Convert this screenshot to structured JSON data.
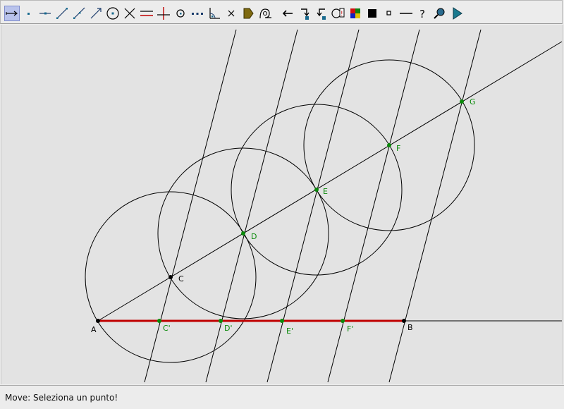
{
  "toolbar": {
    "tools": [
      {
        "name": "move-tool-icon",
        "active": true
      },
      {
        "name": "new-point-tool-icon"
      },
      {
        "name": "point-on-object-tool-icon"
      },
      {
        "name": "segment-tool-icon"
      },
      {
        "name": "ray-tool-icon"
      },
      {
        "name": "vector-tool-icon"
      },
      {
        "name": "circle-tool-icon"
      },
      {
        "name": "intersection-tool-icon"
      },
      {
        "name": "parallel-tool-icon"
      },
      {
        "name": "perpendicular-tool-icon"
      },
      {
        "name": "midpoint-tool-icon"
      },
      {
        "name": "polyline-tool-icon"
      },
      {
        "name": "angle-tool-icon"
      },
      {
        "name": "delete-tool-icon"
      },
      {
        "name": "macro-tool-icon"
      },
      {
        "name": "locus-tool-icon"
      },
      {
        "name": "undo-tool-icon"
      },
      {
        "name": "hide-tool-icon"
      },
      {
        "name": "show-hidden-tool-icon"
      },
      {
        "name": "label-tool-icon"
      },
      {
        "name": "color-tool-icon"
      },
      {
        "name": "fill-tool-icon"
      },
      {
        "name": "point-style-tool-icon"
      },
      {
        "name": "line-style-tool-icon"
      },
      {
        "name": "help-tool-icon"
      },
      {
        "name": "zoom-tool-icon"
      },
      {
        "name": "animation-tool-icon"
      }
    ]
  },
  "points": {
    "A": "A",
    "B": "B",
    "C": "C",
    "D": "D",
    "E": "E",
    "F": "F",
    "G": "G",
    "C1": "C'",
    "D1": "D'",
    "E1": "E'",
    "F1": "F'"
  },
  "colors": {
    "segment": "#c00000",
    "green_point": "#008000",
    "black_point": "#000000",
    "line": "#000000"
  },
  "status": {
    "text": "Move: Seleziona un punto!"
  }
}
